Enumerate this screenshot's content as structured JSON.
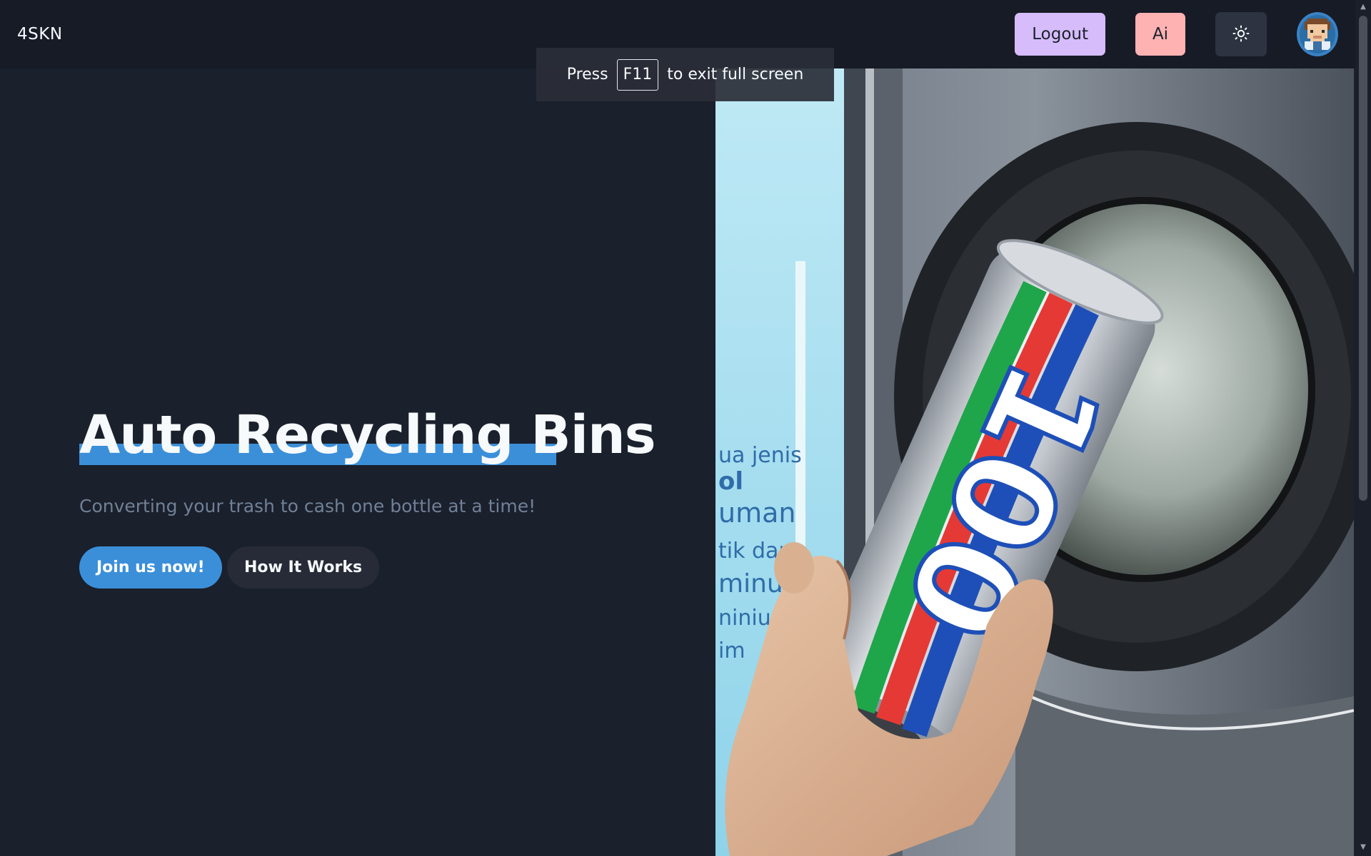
{
  "navbar": {
    "brand": "4SKN",
    "logout_label": "Logout",
    "ai_label": "Ai",
    "theme_icon": "sun-icon",
    "avatar_icon": "pixel-avatar-icon"
  },
  "fullscreen_toast": {
    "prefix": "Press",
    "key": "F11",
    "suffix": "to exit full screen"
  },
  "hero": {
    "title": "Auto Recycling Bins",
    "subtitle": "Converting your trash to cash one bottle at a time!",
    "primary_button": "Join us now!",
    "secondary_button": "How It Works",
    "image_alt": "Hand inserting a 100PLUS can into a recycling machine",
    "can_text": "100PLUS"
  },
  "colors": {
    "background": "#1a202c",
    "navbar": "#171b26",
    "accent_blue": "#3b8fd9",
    "logout_purple": "#d6bcfa",
    "ai_pink": "#feb2b2",
    "subtitle_gray": "#718096"
  }
}
